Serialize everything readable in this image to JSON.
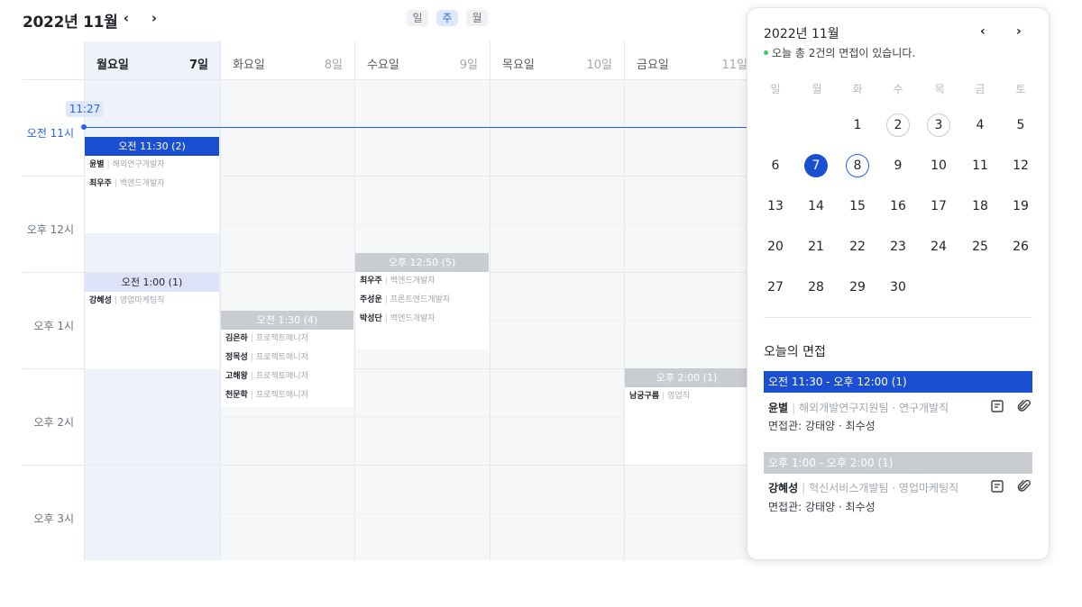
{
  "header": {
    "month": "2022년 11월",
    "prev": "‹",
    "next": "›",
    "views": [
      "일",
      "주",
      "월"
    ],
    "active_view": "주"
  },
  "week": {
    "days": [
      {
        "name": "월요일",
        "num": "7일"
      },
      {
        "name": "화요일",
        "num": "8일"
      },
      {
        "name": "수요일",
        "num": "9일"
      },
      {
        "name": "목요일",
        "num": "10일"
      },
      {
        "name": "금요일",
        "num": "11일"
      }
    ],
    "time_labels": [
      "오전 11시",
      "오후 12시",
      "오후 1시",
      "오후 2시",
      "오후 3시"
    ],
    "current_time": "11:27"
  },
  "events": {
    "mon_1130": {
      "time": "오전 11:30 (2)",
      "rows": [
        {
          "name": "윤별",
          "role": "해외연구개발자"
        },
        {
          "name": "최우주",
          "role": "백엔드개발자"
        }
      ]
    },
    "mon_1300": {
      "time": "오전 1:00 (1)",
      "rows": [
        {
          "name": "강혜성",
          "role": "영업마케팅직"
        }
      ]
    },
    "tue_1330": {
      "time": "오전 1:30 (4)",
      "rows": [
        {
          "name": "김은하",
          "role": "프로젝트매니저"
        },
        {
          "name": "정목성",
          "role": "프로젝트매니저"
        },
        {
          "name": "고해왕",
          "role": "프로젝트매니저"
        },
        {
          "name": "천문학",
          "role": "프로젝트매니저"
        }
      ]
    },
    "wed_1250": {
      "time": "오후 12:50 (5)",
      "rows": [
        {
          "name": "최우주",
          "role": "백엔드개발자"
        },
        {
          "name": "주성운",
          "role": "프론트엔드개발자"
        },
        {
          "name": "박성단",
          "role": "백엔드개발자"
        }
      ]
    },
    "fri_1400": {
      "time": "오후 2:00 (1)",
      "rows": [
        {
          "name": "남궁구름",
          "role": "영업직"
        }
      ]
    }
  },
  "panel": {
    "title": "2022년 11월",
    "prev": "‹",
    "next": "›",
    "subtitle": "오늘 총 2건의 면접이 있습니다.",
    "weekdays": [
      "일",
      "월",
      "화",
      "수",
      "목",
      "금",
      "토"
    ],
    "weeks": [
      [
        "",
        "",
        "1",
        "2",
        "3",
        "4",
        "5"
      ],
      [
        "6",
        "7",
        "8",
        "9",
        "10",
        "11",
        "12"
      ],
      [
        "13",
        "14",
        "15",
        "16",
        "17",
        "18",
        "19"
      ],
      [
        "20",
        "21",
        "22",
        "23",
        "24",
        "25",
        "26"
      ],
      [
        "27",
        "28",
        "29",
        "30",
        "",
        "",
        ""
      ]
    ],
    "selected_date": "7",
    "ringed_date": "8",
    "dates_with_interviews": [
      "2",
      "3"
    ],
    "section_title": "오늘의 면접",
    "interviews": [
      {
        "time": "오전 11:30 - 오후 12:00 (1)",
        "name": "윤별",
        "dept": "해외개발연구지원팀 · 연구개발직",
        "interviewers": "면접관: 강태양 · 최수성"
      },
      {
        "time": "오후 1:00 - 오후 2:00 (1)",
        "name": "강혜성",
        "dept": "혁신서비스개발팀 · 영업마케팅직",
        "interviewers": "면접관: 강태양 · 최수성"
      }
    ]
  },
  "icons": {
    "memo": "memo-icon",
    "attach": "paperclip-icon"
  },
  "colors": {
    "accent": "#1b4fd1",
    "today_bg": "#eef2fb",
    "pending": "#c9ccd1",
    "status_dot": "#2bd26a"
  }
}
